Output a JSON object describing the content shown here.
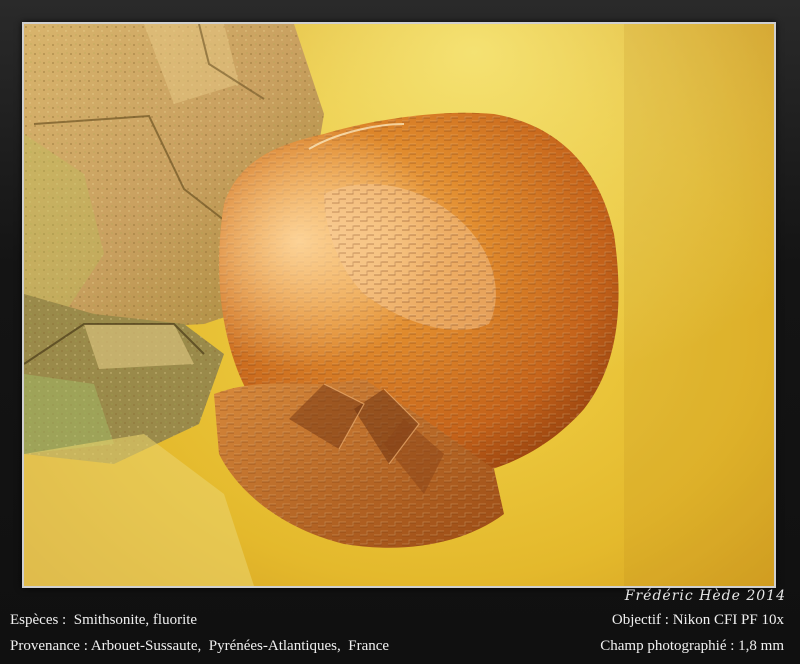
{
  "photo": {
    "subject": "mineral-micrograph",
    "colors": {
      "background": "#e8c23a",
      "crystal": "#c96a1c",
      "matrix": "#c9a86a"
    }
  },
  "signature": "Frédéric Hède 2014",
  "caption": {
    "species_label": "Espèces :",
    "species_value": "Smithsonite, fluorite",
    "provenance_label": "Provenance :",
    "provenance_value": "Arbouet-Sussaute,  Pyrénées-Atlantiques,  France",
    "objective_label": "Objectif :",
    "objective_value": "Nikon CFI PF 10x",
    "field_label": "Champ photographié :",
    "field_value": "1,8 mm"
  }
}
